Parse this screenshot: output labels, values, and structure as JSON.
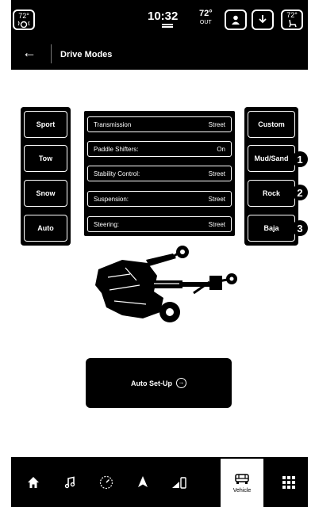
{
  "status_bar": {
    "left_climate_temp": "72°",
    "time": "10:32",
    "outside_temp": "72°",
    "outside_label": "OUT",
    "right_climate_temp": "72°"
  },
  "header": {
    "title": "Drive Modes"
  },
  "modes_left": [
    {
      "label": "Sport"
    },
    {
      "label": "Tow"
    },
    {
      "label": "Snow"
    },
    {
      "label": "Auto"
    }
  ],
  "modes_right": [
    {
      "label": "Custom"
    },
    {
      "label": "Mud/Sand"
    },
    {
      "label": "Rock"
    },
    {
      "label": "Baja"
    }
  ],
  "callouts": [
    "1",
    "2",
    "3"
  ],
  "settings": [
    {
      "name": "Transmission",
      "value": "Street"
    },
    {
      "name": "Paddle Shifters:",
      "value": "On"
    },
    {
      "name": "Stability Control:",
      "value": "Street"
    },
    {
      "name": "Suspension:",
      "value": "Street"
    },
    {
      "name": "Steering:",
      "value": "Street"
    }
  ],
  "auto_setup": {
    "label": "Auto Set-Up"
  },
  "nav": {
    "active_label": "Vehicle"
  }
}
